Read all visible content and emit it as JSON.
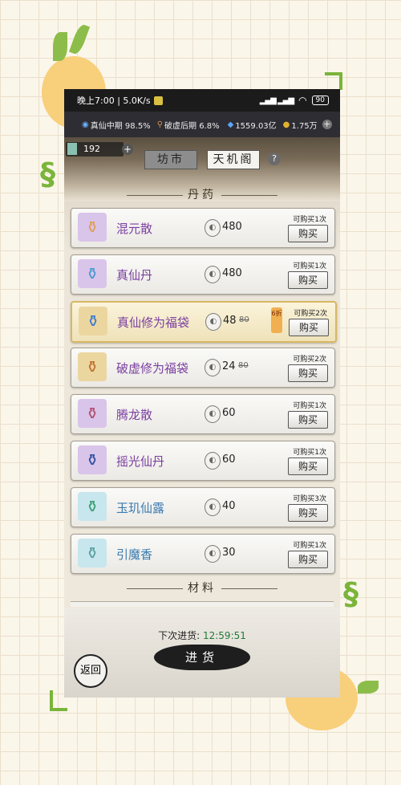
{
  "status_bar": {
    "time_speed": "晚上7:00 | 5.0K/s",
    "battery": "90"
  },
  "resources": {
    "cultivation": "真仙中期 98.5%",
    "breakthrough": "破虚后期 6.8%",
    "spirit_stones": "1559.03亿",
    "gold": "1.75万"
  },
  "jade_count": "192",
  "tabs": {
    "market": "坊市",
    "pavilion": "天机阁"
  },
  "sections": {
    "pills": "丹药",
    "materials": "材料"
  },
  "items": [
    {
      "name": "混元散",
      "price": "480",
      "old_price": "",
      "limit": "可购买1次",
      "buy": "购买",
      "highlight": false,
      "name_color": "#7a3fa0",
      "icon_bg": "#d9c4ea",
      "icon_color": "#e0a050",
      "discount": ""
    },
    {
      "name": "真仙丹",
      "price": "480",
      "old_price": "",
      "limit": "可购买1次",
      "buy": "购买",
      "highlight": false,
      "name_color": "#7a3fa0",
      "icon_bg": "#d9c4ea",
      "icon_color": "#4a9ad0",
      "discount": ""
    },
    {
      "name": "真仙修为福袋",
      "price": "48",
      "old_price": "80",
      "limit": "可购买2次",
      "buy": "购买",
      "highlight": true,
      "name_color": "#7a3fa0",
      "icon_bg": "#ecd6a0",
      "icon_color": "#3a7ad0",
      "discount": "6折"
    },
    {
      "name": "破虚修为福袋",
      "price": "24",
      "old_price": "80",
      "limit": "可购买2次",
      "buy": "购买",
      "highlight": false,
      "name_color": "#7a3fa0",
      "icon_bg": "#ecd6a0",
      "icon_color": "#c07030",
      "discount": ""
    },
    {
      "name": "腾龙散",
      "price": "60",
      "old_price": "",
      "limit": "可购买1次",
      "buy": "购买",
      "highlight": false,
      "name_color": "#7a3fa0",
      "icon_bg": "#d9c4ea",
      "icon_color": "#b05070",
      "discount": ""
    },
    {
      "name": "摇光仙丹",
      "price": "60",
      "old_price": "",
      "limit": "可购买1次",
      "buy": "购买",
      "highlight": false,
      "name_color": "#7a3fa0",
      "icon_bg": "#d9c4ea",
      "icon_color": "#3050a0",
      "discount": ""
    },
    {
      "name": "玉玑仙露",
      "price": "40",
      "old_price": "",
      "limit": "可购买3次",
      "buy": "购买",
      "highlight": false,
      "name_color": "#3a7ab0",
      "icon_bg": "#c8e6ee",
      "icon_color": "#3aa070",
      "discount": ""
    },
    {
      "name": "引魔香",
      "price": "30",
      "old_price": "",
      "limit": "可购买1次",
      "buy": "购买",
      "highlight": false,
      "name_color": "#3a7ab0",
      "icon_bg": "#c8e6ee",
      "icon_color": "#5aa0a0",
      "discount": ""
    }
  ],
  "restock": {
    "label": "下次进货:",
    "time": "12:59:51"
  },
  "restock_button": "进货",
  "back_button": "返回"
}
